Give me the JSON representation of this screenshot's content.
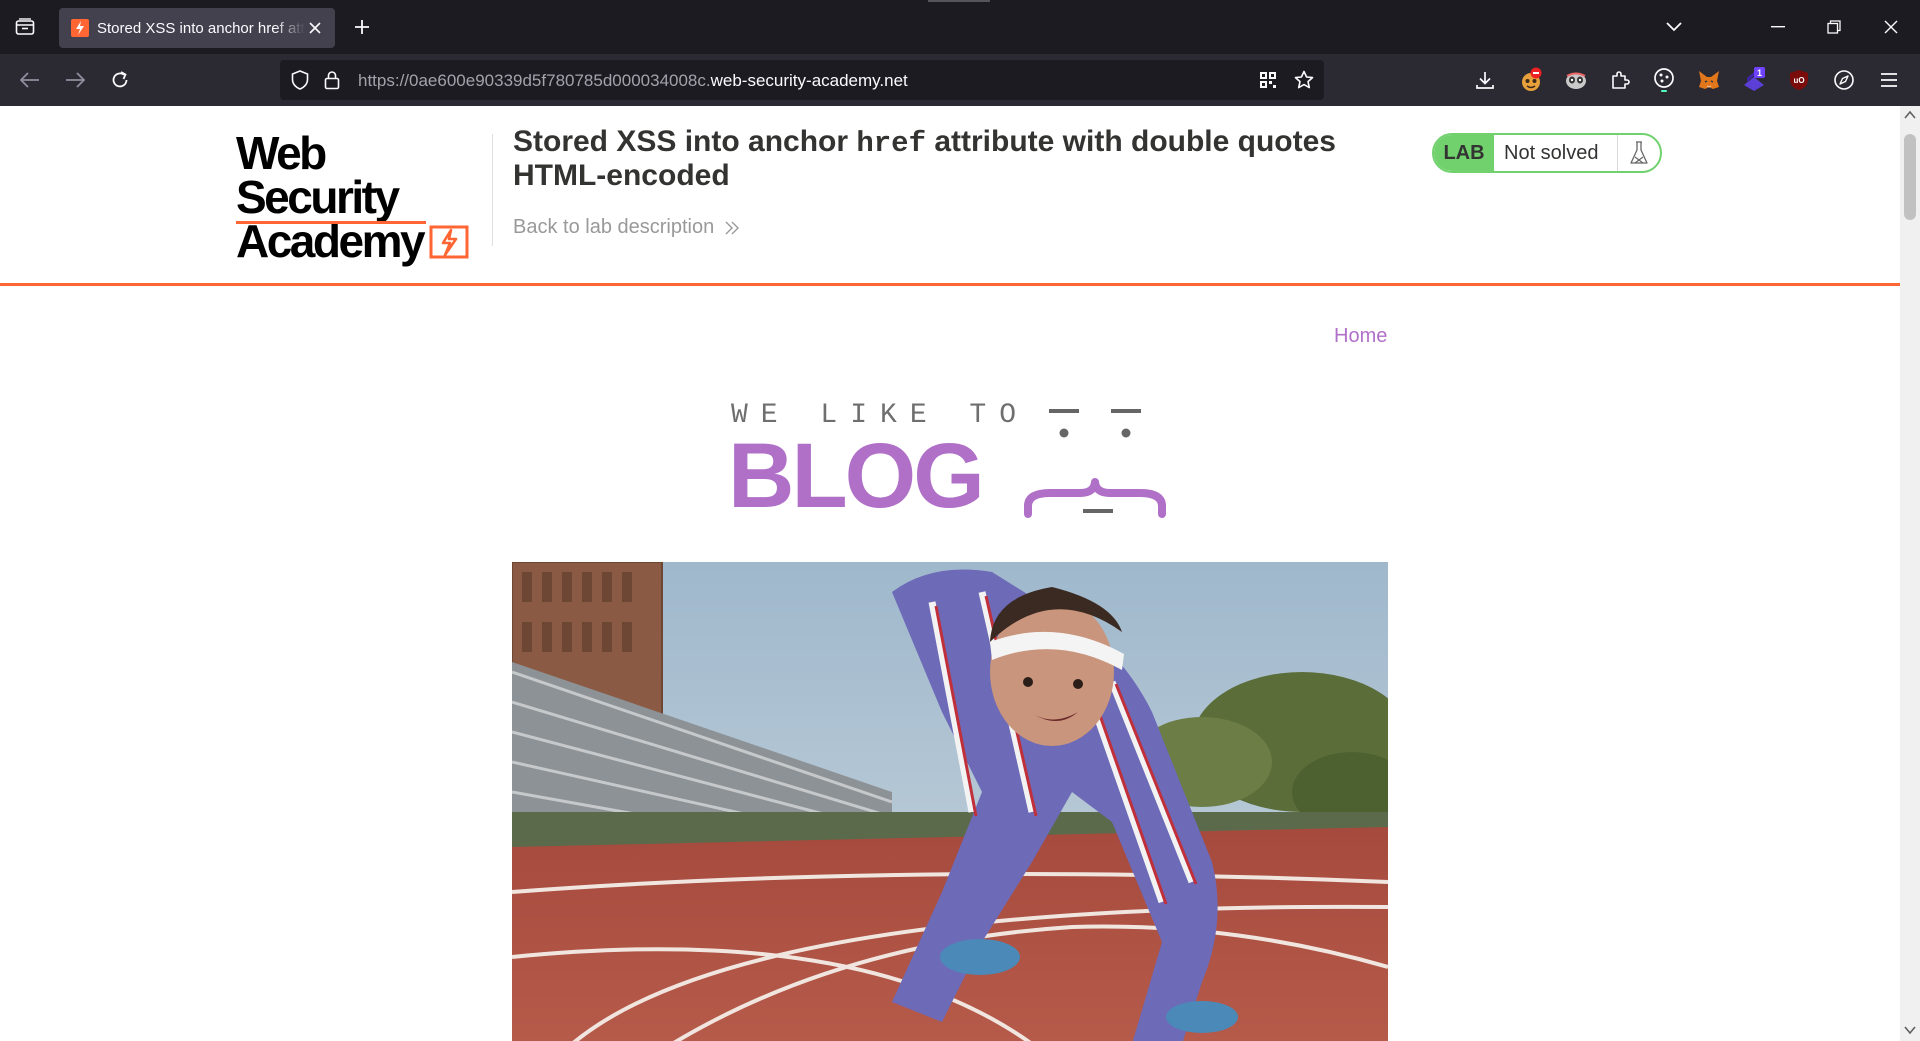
{
  "browser": {
    "tab": {
      "title": "Stored XSS into anchor href attribute with double quotes HTML-encoded"
    },
    "url": {
      "prefix": "https://0ae600e90339d5f780785d000034008c.",
      "domain": "web-security-academy.net"
    },
    "extensions": [
      "download-icon",
      "ublock-origin-icon",
      "privacy-badger-icon",
      "extensions-puzzle-icon",
      "cookie-icon",
      "metamask-fox-icon",
      "notification-extension-icon",
      "ublock-icon",
      "compass-icon",
      "menu-icon"
    ],
    "extension_badge": "1",
    "colors": {
      "tabbar": "#1c1b22",
      "navbar": "#2b2a33",
      "urlbar": "#1c1b22"
    }
  },
  "academy": {
    "logo_line1": "Web Security",
    "logo_line2": "Academy",
    "lab_title_pre": "Stored XSS into anchor ",
    "lab_title_code": "href",
    "lab_title_post": " attribute with double quotes HTML-encoded",
    "back_link": "Back to lab description",
    "lab_badge": "LAB",
    "lab_status": "Not solved",
    "colors": {
      "accent": "#ff6633",
      "lab_green": "#70d16d"
    }
  },
  "blog": {
    "nav_home": "Home",
    "logo_small": "WE LIKE TO",
    "logo_big": "BLOG",
    "colors": {
      "purple": "#b070c8"
    },
    "hero_image": "runner-on-track"
  }
}
